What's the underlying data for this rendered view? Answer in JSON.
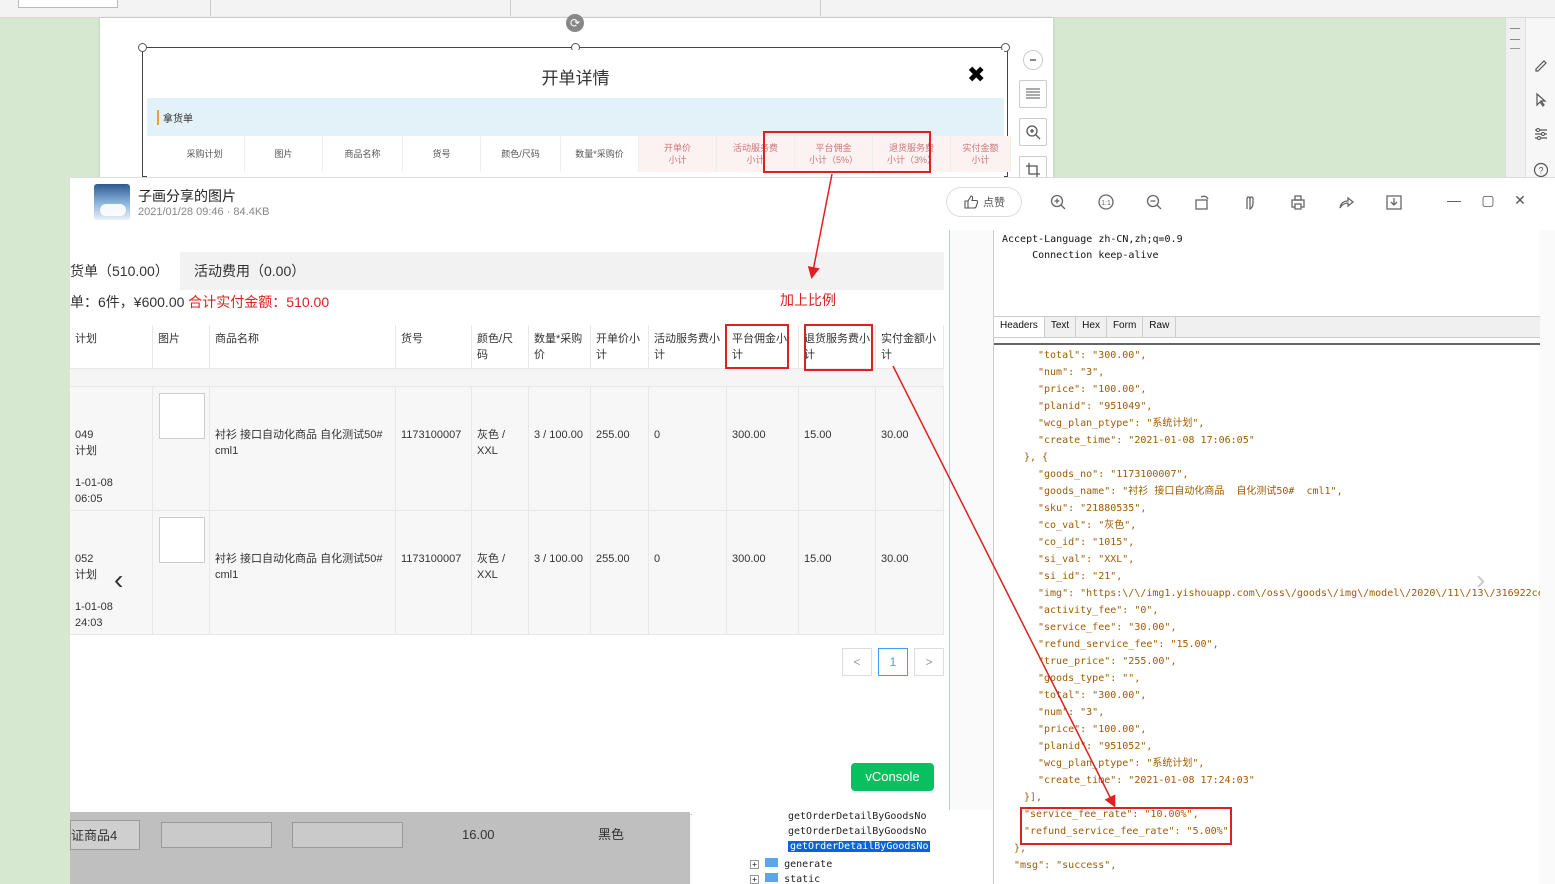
{
  "modal": {
    "title": "开单详情",
    "close_glyph": "✖",
    "band_label": "拿货单",
    "headers": [
      {
        "l1": "采购计划",
        "l2": ""
      },
      {
        "l1": "图片",
        "l2": ""
      },
      {
        "l1": "商品名称",
        "l2": ""
      },
      {
        "l1": "货号",
        "l2": ""
      },
      {
        "l1": "颜色/尺码",
        "l2": ""
      },
      {
        "l1": "数量*采购价",
        "l2": ""
      },
      {
        "l1": "开单价",
        "l2": "小计"
      },
      {
        "l1": "活动服务费",
        "l2": "小计"
      },
      {
        "l1": "平台佣金",
        "l2": "小计（5%）"
      },
      {
        "l1": "退货服务费",
        "l2": "小计（3%）"
      },
      {
        "l1": "实付金额",
        "l2": "小计"
      }
    ]
  },
  "viewer": {
    "title": "子画分享的图片",
    "meta": "2021/01/28 09:46 · 84.4KB",
    "like_label": "点赞",
    "toolbar_icons": [
      "zoom-in-icon",
      "actual-size-icon",
      "zoom-out-icon",
      "rotate-icon",
      "hand-icon",
      "print-icon",
      "share-icon",
      "download-icon"
    ],
    "prev_glyph": "‹",
    "next_glyph": "›"
  },
  "web": {
    "tabs": [
      "货单（510.00）",
      "活动费用（0.00）"
    ],
    "summary_prefix": "单：6件，¥600.00",
    "summary_total": "合计实付金额：510.00",
    "headers": [
      "计划",
      "图片",
      "商品名称",
      "货号",
      "颜色/尺码",
      "数量*采购价",
      "开单价小计",
      "活动服务费小计",
      "平台佣金小计",
      "退货服务费小计",
      "实付金额小计"
    ],
    "rows": [
      {
        "plan": "049",
        "plan2": "计划",
        "date": "1-01-08",
        "time": "06:05",
        "name": "衬衫 接口自动化商品 自化测试50# cml1",
        "goods_no": "1173100007",
        "spec": "灰色 / XXL",
        "qty": "3 / 100.00",
        "open_price": "255.00",
        "activity": "0",
        "platform": "300.00",
        "refund": "15.00",
        "paid": "30.00"
      },
      {
        "plan": "052",
        "plan2": "计划",
        "date": "1-01-08",
        "time": "24:03",
        "name": "衬衫 接口自动化商品 自化测试50# cml1",
        "goods_no": "1173100007",
        "spec": "灰色 / XXL",
        "qty": "3 / 100.00",
        "open_price": "255.00",
        "activity": "0",
        "platform": "300.00",
        "refund": "15.00",
        "paid": "30.00"
      }
    ],
    "pager": {
      "prev": "<",
      "current": "1",
      "next": ">"
    },
    "vconsole": "vConsole"
  },
  "annotation": {
    "label": "加上比例",
    "color": "#e02020"
  },
  "fiddler": {
    "headers_text": "Accept-Language zh-CN,zh;q=0.9\n     Connection keep-alive",
    "tabs": [
      "Headers",
      "Text",
      "Hex",
      "Form",
      "Raw"
    ],
    "json_lines": [
      "\"total\": \"300.00\",",
      "\"num\": \"3\",",
      "\"price\": \"100.00\",",
      "\"planid\": \"951049\",",
      "\"wcg_plan_ptype\": \"系统计划\",",
      "\"create_time\": \"2021-01-08 17:06:05\"",
      "}, {",
      "\"goods_no\": \"1173100007\",",
      "\"goods_name\": \"衬衫 接口自动化商品  自化测试50#  cml1\",",
      "\"sku\": \"21880535\",",
      "\"co_val\": \"灰色\",",
      "\"co_id\": \"1015\",",
      "\"si_val\": \"XXL\",",
      "\"si_id\": \"21\",",
      "\"img\": \"https:\\/\\/img1.yishouapp.com\\/oss\\/goods\\/img\\/model\\/2020\\/11\\/13\\/316922ce",
      "\"activity_fee\": \"0\",",
      "\"service_fee\": \"30.00\",",
      "\"refund_service_fee\": \"15.00\",",
      "\"true_price\": \"255.00\",",
      "\"goods_type\": \"\",",
      "\"total\": \"300.00\",",
      "\"num\": \"3\",",
      "\"price\": \"100.00\",",
      "\"planid\": \"951052\",",
      "\"wcg_plan_ptype\": \"系统计划\",",
      "\"create_time\": \"2021-01-08 17:24:03\"",
      "}],",
      "\"service_fee_rate\": \"10.00%\",",
      "\"refund_service_fee_rate\": \"5.00%\"",
      "},",
      "\"msg\": \"success\","
    ]
  },
  "tree": {
    "items": [
      "getOrderDetailByGoodsNo",
      "getOrderDetailByGoodsNo",
      "getOrderDetailByGoodsNo",
      "generate",
      "static"
    ]
  },
  "doc_strip": {
    "cells": [
      "证商品4",
      "16.00",
      "黑色"
    ]
  }
}
